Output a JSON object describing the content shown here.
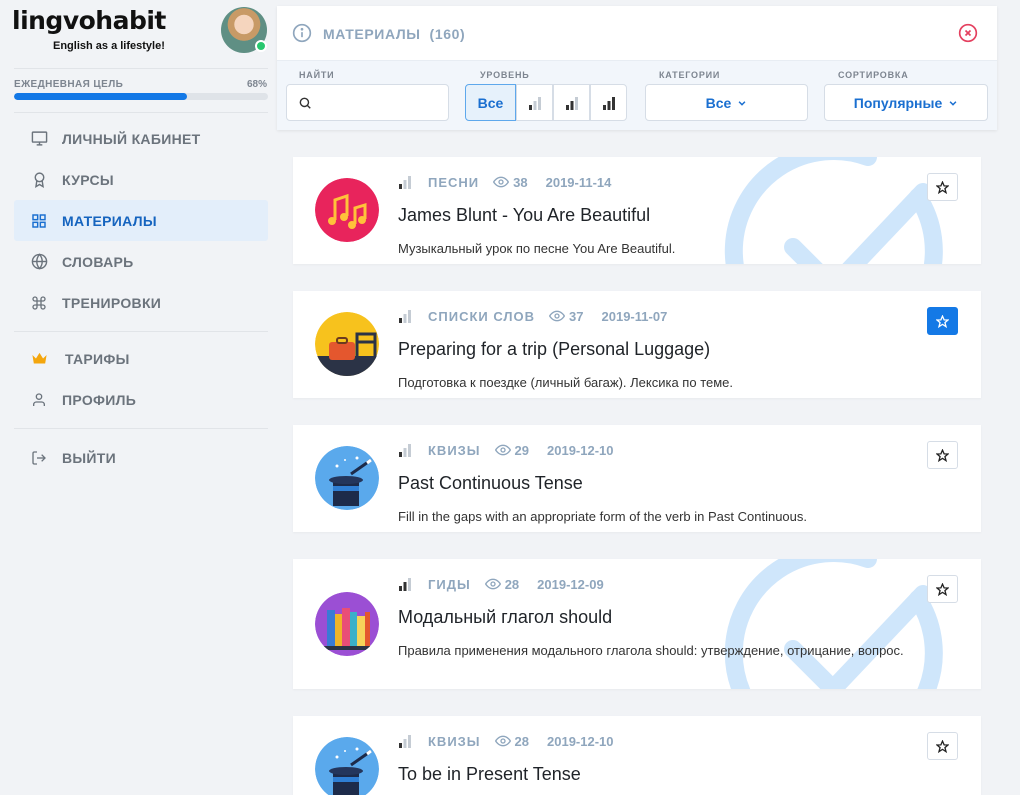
{
  "app": {
    "logo": "lingvohabit",
    "tagline": "English as a lifestyle!"
  },
  "goal": {
    "label": "ЕЖЕДНЕВНАЯ ЦЕЛЬ",
    "percent_label": "68%",
    "progress": 68
  },
  "sidebar": {
    "items": [
      {
        "label": "ЛИЧНЫЙ КАБИНЕТ",
        "icon": "monitor-icon"
      },
      {
        "label": "КУРСЫ",
        "icon": "award-icon"
      },
      {
        "label": "МАТЕРИАЛЫ",
        "icon": "grid-icon",
        "active": true
      },
      {
        "label": "СЛОВАРЬ",
        "icon": "globe-icon"
      },
      {
        "label": "ТРЕНИРОВКИ",
        "icon": "command-icon"
      },
      {
        "label": "ТАРИФЫ",
        "icon": "crown-icon"
      },
      {
        "label": "ПРОФИЛЬ",
        "icon": "user-icon"
      },
      {
        "label": "ВЫЙТИ",
        "icon": "logout-icon"
      }
    ]
  },
  "panel": {
    "title": "МАТЕРИАЛЫ  (160)",
    "filters": {
      "search_label": "НАЙТИ",
      "search_placeholder": "",
      "level_label": "УРОВЕНЬ",
      "level_all": "Все",
      "category_label": "КАТЕГОРИИ",
      "category_value": "Все",
      "sort_label": "СОРТИРОВКА",
      "sort_value": "Популярные"
    }
  },
  "colors": {
    "accent": "#1479e6",
    "muted": "#8fa6bd",
    "check": "#cfe6fb",
    "close": "#e4405f"
  },
  "cards": [
    {
      "category": "ПЕСНИ",
      "views": "38",
      "date": "2019-11-14",
      "title": "James Blunt - You Are Beautiful",
      "description": "Музыкальный урок по песне You Are Beautiful.",
      "level": 1,
      "favorite": false,
      "completed": true,
      "image": "music-notes-icon"
    },
    {
      "category": "СПИСКИ СЛОВ",
      "views": "37",
      "date": "2019-11-07",
      "title": "Preparing for a trip (Personal Luggage)",
      "description": "Подготовка к поездке (личный багаж). Лексика по теме.",
      "level": 1,
      "favorite": true,
      "completed": false,
      "image": "luggage-icon"
    },
    {
      "category": "КВИЗЫ",
      "views": "29",
      "date": "2019-12-10",
      "title": "Past Continuous Tense",
      "description": "Fill in the gaps with an appropriate form of the verb in Past Continuous.",
      "level": 1,
      "favorite": false,
      "completed": false,
      "image": "magic-hat-icon"
    },
    {
      "category": "ГИДЫ",
      "views": "28",
      "date": "2019-12-09",
      "title": "Модальный глагол should",
      "description": "Правила применения модального глагола should: утверждение, отрицание, вопрос.",
      "level": 2,
      "favorite": false,
      "completed": true,
      "image": "books-icon"
    },
    {
      "category": "КВИЗЫ",
      "views": "28",
      "date": "2019-12-10",
      "title": "To be in Present Tense",
      "description": "",
      "level": 1,
      "favorite": false,
      "completed": false,
      "image": "magic-hat-icon"
    }
  ]
}
